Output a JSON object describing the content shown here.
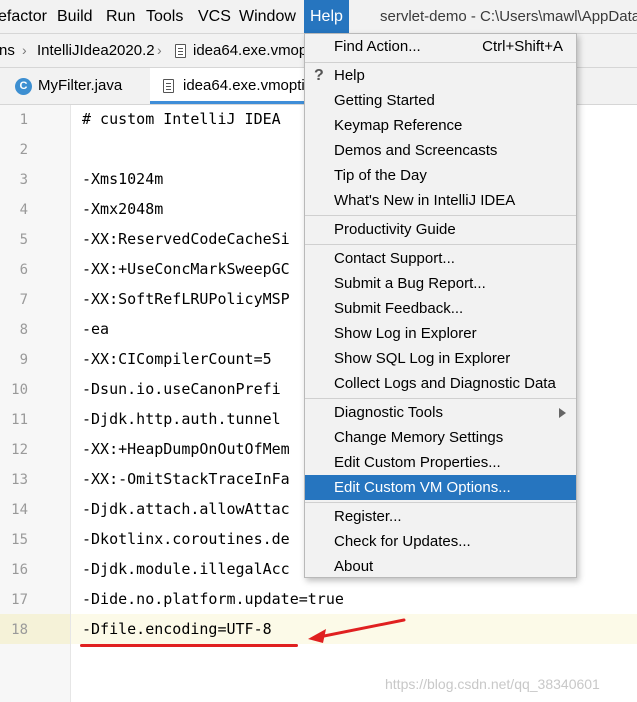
{
  "menubar": {
    "items": [
      "efactor",
      "Build",
      "Run",
      "Tools",
      "VCS",
      "Window",
      "Help"
    ],
    "title": "servlet-demo - C:\\Users\\mawl\\AppData"
  },
  "breadcrumb": {
    "items": [
      "ns",
      "IntelliJIdea2020.2",
      "idea64.exe.vmop"
    ]
  },
  "tabs": [
    {
      "label": "MyFilter.java",
      "icon": "class-c-icon"
    },
    {
      "label": "idea64.exe.vmoptio",
      "icon": "file-icon"
    }
  ],
  "editor": {
    "lines": [
      {
        "num": "1",
        "text": "# custom IntelliJ IDEA"
      },
      {
        "num": "2",
        "text": ""
      },
      {
        "num": "3",
        "text": "-Xms1024m"
      },
      {
        "num": "4",
        "text": "-Xmx2048m"
      },
      {
        "num": "5",
        "text": "-XX:ReservedCodeCacheSi"
      },
      {
        "num": "6",
        "text": "-XX:+UseConcMarkSweepGC"
      },
      {
        "num": "7",
        "text": "-XX:SoftRefLRUPolicyMSP"
      },
      {
        "num": "8",
        "text": "-ea"
      },
      {
        "num": "9",
        "text": "-XX:CICompilerCount=5"
      },
      {
        "num": "10",
        "text": "-Dsun.io.useCanonPrefi"
      },
      {
        "num": "11",
        "text": "-Djdk.http.auth.tunnel"
      },
      {
        "num": "12",
        "text": "-XX:+HeapDumpOnOutOfMem"
      },
      {
        "num": "13",
        "text": "-XX:-OmitStackTraceInFa"
      },
      {
        "num": "14",
        "text": "-Djdk.attach.allowAttac"
      },
      {
        "num": "15",
        "text": "-Dkotlinx.coroutines.de"
      },
      {
        "num": "16",
        "text": "-Djdk.module.illegalAcc"
      },
      {
        "num": "17",
        "text": "-Dide.no.platform.update=true"
      },
      {
        "num": "18",
        "text": "-Dfile.encoding=UTF-8"
      }
    ]
  },
  "help_menu": {
    "find_action": {
      "label": "Find Action...",
      "shortcut": "Ctrl+Shift+A"
    },
    "items": [
      "Help",
      "Getting Started",
      "Keymap Reference",
      "Demos and Screencasts",
      "Tip of the Day",
      "What's New in IntelliJ IDEA",
      "Productivity Guide",
      "Contact Support...",
      "Submit a Bug Report...",
      "Submit Feedback...",
      "Show Log in Explorer",
      "Show SQL Log in Explorer",
      "Collect Logs and Diagnostic Data",
      "Diagnostic Tools",
      "Change Memory Settings",
      "Edit Custom Properties...",
      "Edit Custom VM Options...",
      "Register...",
      "Check for Updates...",
      "About"
    ],
    "selected": "Edit Custom VM Options..."
  },
  "watermark": "https://blog.csdn.net/qq_38340601",
  "colors": {
    "menu_highlight": "#2675bf",
    "annotation_red": "#e02020",
    "current_line": "#fcfae8"
  }
}
